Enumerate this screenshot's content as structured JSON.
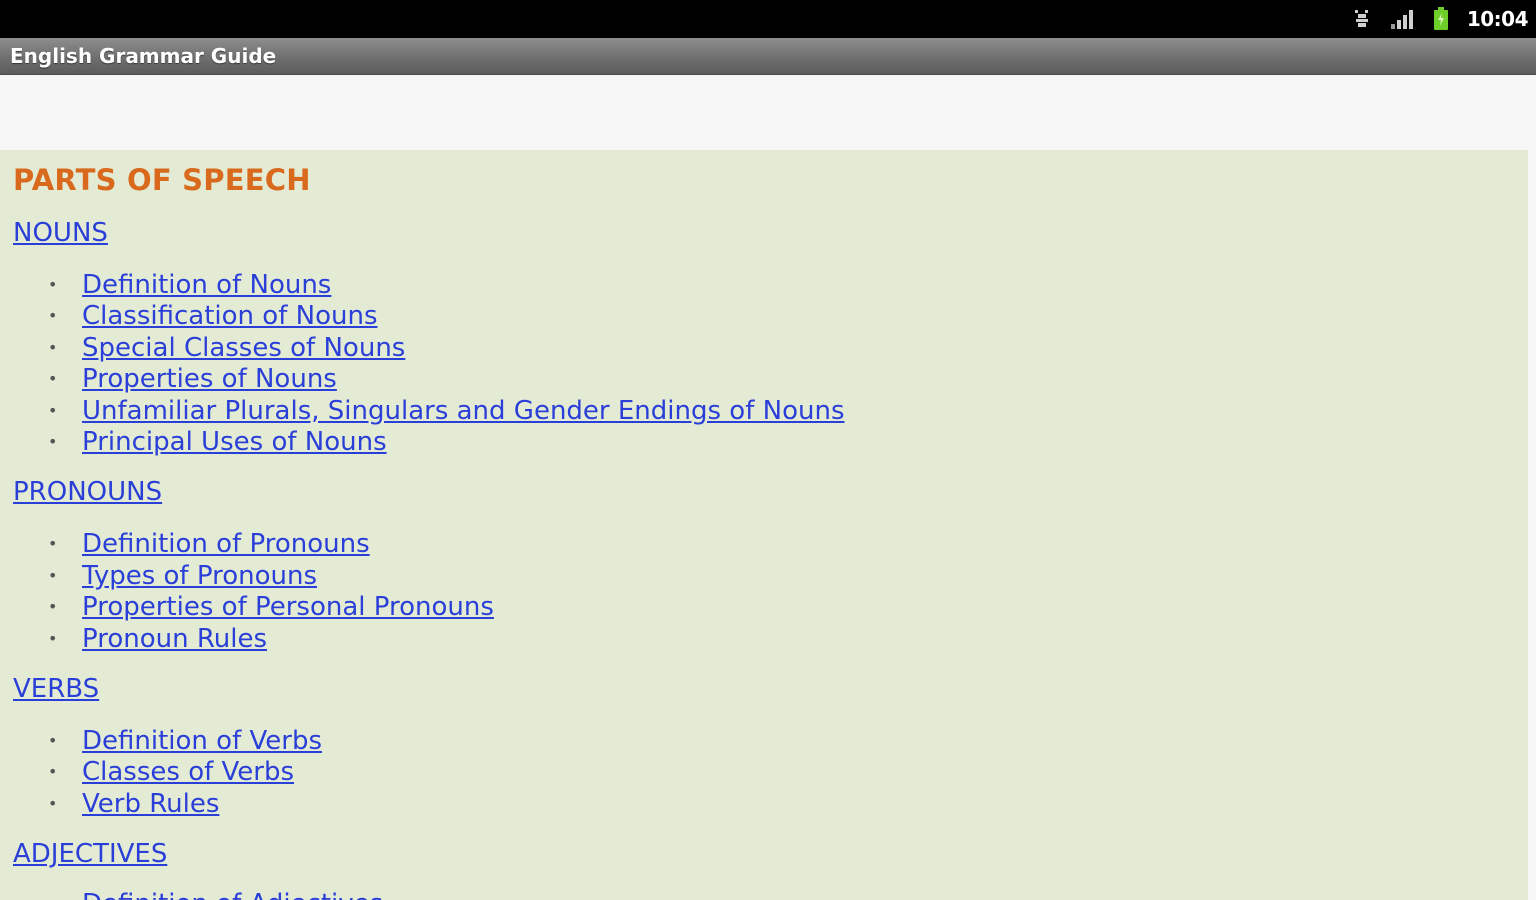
{
  "status_bar": {
    "time": "10:04",
    "icons": [
      "usb-debug-icon",
      "signal-icon",
      "battery-icon"
    ],
    "battery_color": "#6fcf2a"
  },
  "app": {
    "title": "English Grammar Guide"
  },
  "content": {
    "heading": "PARTS OF SPEECH",
    "colors": {
      "background": "#e4ebd5",
      "heading": "#d9691c",
      "link": "#2a3fd8"
    },
    "categories": [
      {
        "label": "NOUNS",
        "items": [
          "Definition of Nouns",
          "Classification of Nouns",
          "Special Classes of Nouns",
          "Properties of Nouns",
          "Unfamiliar Plurals, Singulars and Gender Endings of Nouns",
          "Principal Uses of Nouns"
        ]
      },
      {
        "label": "PRONOUNS",
        "items": [
          "Definition of Pronouns",
          "Types of Pronouns",
          "Properties of Personal Pronouns",
          "Pronoun Rules"
        ]
      },
      {
        "label": "VERBS",
        "items": [
          "Definition of Verbs",
          "Classes of Verbs",
          "Verb Rules"
        ]
      },
      {
        "label": "ADJECTIVES",
        "items": [
          "Definition of Adjectives"
        ]
      }
    ]
  }
}
